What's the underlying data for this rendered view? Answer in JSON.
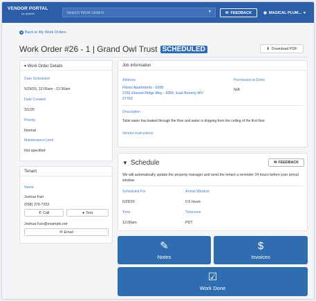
{
  "topbar": {
    "brand_title": "VENDOR PORTAL",
    "brand_sub": "by appfolio",
    "search_placeholder": "Search Work Orders",
    "feedback_label": "FEEDBACK",
    "user_label": "MAGICAL PLUM..."
  },
  "nav": {
    "back_label": "Back to My Work Orders"
  },
  "header": {
    "title": "Work Order #26 - 1 | Grand Owl Trust",
    "status": "SCHEDULED",
    "download_label": "Download PDF"
  },
  "work_order_details": {
    "heading": "Work Order Details",
    "date_scheduled_label": "Date Scheduled",
    "date_scheduled": "5/29/20, 12:00am - 12:30am",
    "date_created_label": "Date Created",
    "date_created": "3/1/20",
    "priority_label": "Priority",
    "priority": "Normal",
    "maintenance_limit_label": "Maintenance Limit",
    "maintenance_limit": "Not specified"
  },
  "tenant": {
    "heading": "Tenant",
    "name_label": "Name",
    "name": "Joshua Farr",
    "phone": "(558) 379-7253",
    "call_label": "Call",
    "text_label": "Text",
    "email": "Joshua.Farr@example.net",
    "email_label": "Email"
  },
  "job": {
    "heading": "Job Information",
    "address_label": "Address",
    "address_line1": "Floros Apartments - 5000",
    "address_line2": "2781 Elwood Ridge Way - 5000, East Beverly WV",
    "address_line3": "27763",
    "permission_label": "Permission to Enter",
    "permission": "N/A",
    "description_label": "Description",
    "description": "Toilet water has leaked through the floor and water is dripping from the ceiling of the first floor",
    "vendor_instructions_label": "Vendor Instructions"
  },
  "schedule": {
    "heading": "Schedule",
    "feedback_label": "FEEDBACK",
    "notice": "We will automatically update the property manager and send the tenant a reminder 24 hours before your arrival window.",
    "scheduled_for_label": "Scheduled For",
    "scheduled_for": "5/29/20",
    "arrival_window_label": "Arrival Window",
    "arrival_window": "0.5 hours",
    "time_label": "Time",
    "time": "12:00am",
    "timezone_label": "Timezone",
    "timezone": "PDT"
  },
  "tiles": {
    "notes": "Notes",
    "invoices": "Invoices",
    "work_done": "Work Done"
  },
  "colors": {
    "brand": "#2d5ea8",
    "accent": "#2f6db0",
    "label": "#4a7fc1"
  }
}
